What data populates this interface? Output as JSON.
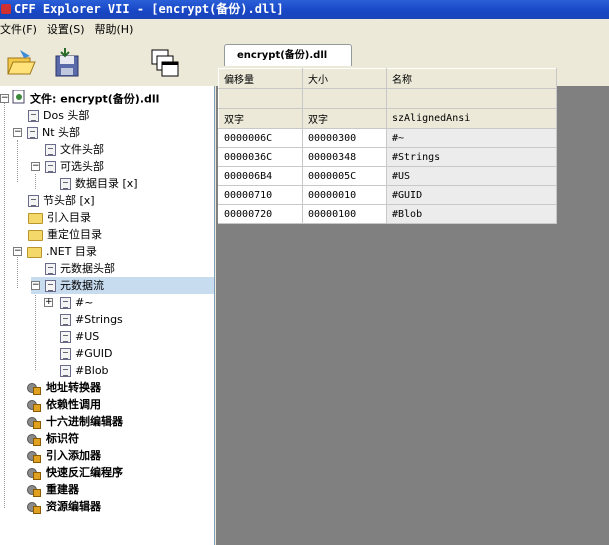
{
  "window": {
    "title": "CFF Explorer VII - [encrypt(备份).dll]"
  },
  "menu": [
    "文件(F)",
    "设置(S)",
    "帮助(H)"
  ],
  "toolbar": {
    "buttons": [
      "open-icon",
      "save-icon",
      "windows-icon"
    ]
  },
  "tab": {
    "label": "encrypt(备份).dll"
  },
  "tree": {
    "root": "文件: encrypt(备份).dll",
    "dos_header": "Dos 头部",
    "nt_header": "Nt 头部",
    "file_header": "文件头部",
    "optional_header": "可选头部",
    "data_directories": "数据目录 [x]",
    "section_headers": "节头部 [x]",
    "import_directory": "引入目录",
    "relocation_directory": "重定位目录",
    "net_directory": ".NET 目录",
    "metadata_header": "元数据头部",
    "metadata_streams": "元数据流",
    "streams": [
      "#~",
      "#Strings",
      "#US",
      "#GUID",
      "#Blob"
    ],
    "tools": [
      "地址转换器",
      "依赖性调用",
      "十六进制编辑器",
      "标识符",
      "引入添加器",
      "快速反汇编程序",
      "重建器",
      "资源编辑器"
    ]
  },
  "table": {
    "headers": [
      "偏移量",
      "大小",
      "名称"
    ],
    "types": [
      "双字",
      "双字",
      "szAlignedAnsi"
    ],
    "rows": [
      [
        "0000006C",
        "00000300",
        "#~"
      ],
      [
        "0000036C",
        "00000348",
        "#Strings"
      ],
      [
        "000006B4",
        "0000005C",
        "#US"
      ],
      [
        "00000710",
        "00000010",
        "#GUID"
      ],
      [
        "00000720",
        "00000100",
        "#Blob"
      ]
    ]
  },
  "colors": {
    "title_bar": "#1846c4",
    "selection": "#c8dcf0",
    "workspace": "#808080"
  }
}
